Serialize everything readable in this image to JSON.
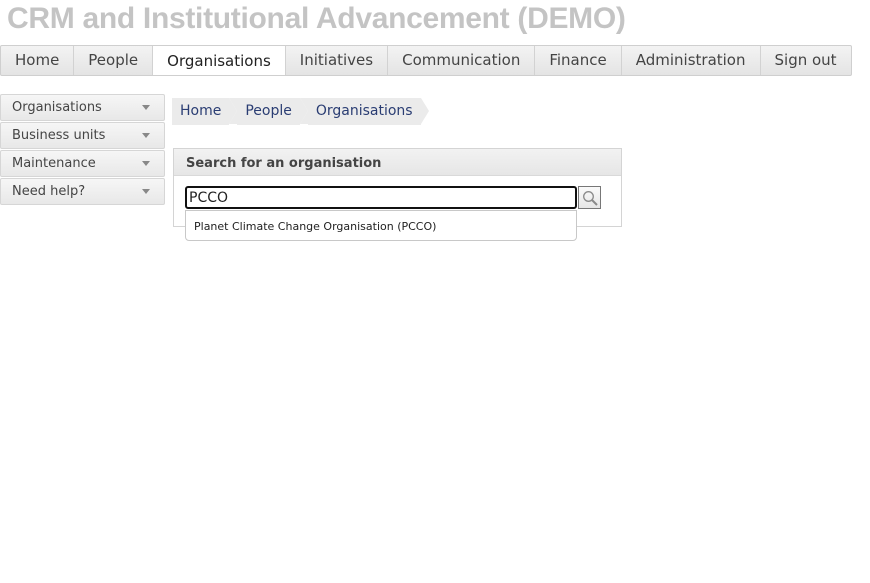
{
  "app": {
    "title": "CRM and Institutional Advancement (DEMO)"
  },
  "topnav": {
    "tabs": [
      {
        "label": "Home"
      },
      {
        "label": "People"
      },
      {
        "label": "Organisations",
        "active": true
      },
      {
        "label": "Initiatives"
      },
      {
        "label": "Communication"
      },
      {
        "label": "Finance"
      },
      {
        "label": "Administration"
      },
      {
        "label": "Sign out"
      }
    ]
  },
  "sidebar": {
    "items": [
      {
        "label": "Organisations"
      },
      {
        "label": "Business units"
      },
      {
        "label": "Maintenance"
      },
      {
        "label": "Need help?"
      }
    ]
  },
  "breadcrumb": {
    "items": [
      {
        "label": "Home"
      },
      {
        "label": "People"
      },
      {
        "label": "Organisations"
      }
    ]
  },
  "search": {
    "title": "Search for an organisation",
    "value": "PCCO",
    "button_icon": "search-icon"
  },
  "suggestions": {
    "items": [
      {
        "label": "Planet Climate Change Organisation (PCCO)"
      }
    ]
  },
  "colors": {
    "title_gray": "#c4c4c4",
    "breadcrumb_text": "#2a3d73",
    "input_border": "#111111"
  }
}
